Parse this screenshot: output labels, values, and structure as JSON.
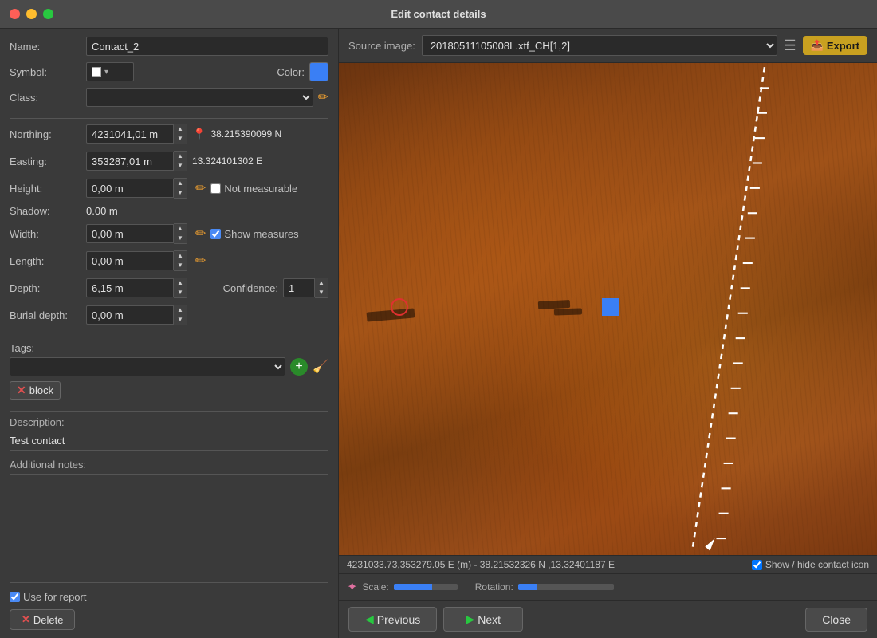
{
  "window": {
    "title": "Edit contact details"
  },
  "left_panel": {
    "name_label": "Name:",
    "name_value": "Contact_2",
    "symbol_label": "Symbol:",
    "color_label": "Color:",
    "class_label": "Class:",
    "northing_label": "Northing:",
    "northing_value": "4231041,01 m",
    "northing_coords": "38.215390099 N",
    "easting_label": "Easting:",
    "easting_value": "353287,01 m",
    "easting_coords": "13.324101302 E",
    "height_label": "Height:",
    "height_value": "0,00 m",
    "not_measurable_label": "Not measurable",
    "shadow_label": "Shadow:",
    "shadow_value": "0.00 m",
    "width_label": "Width:",
    "width_value": "0,00 m",
    "show_measures_label": "Show measures",
    "length_label": "Length:",
    "length_value": "0,00 m",
    "depth_label": "Depth:",
    "depth_value": "6,15 m",
    "confidence_label": "Confidence:",
    "confidence_value": "1",
    "burial_depth_label": "Burial depth:",
    "burial_depth_value": "0,00 m",
    "tags_label": "Tags:",
    "tag_block": "block",
    "description_label": "Description:",
    "description_value": "Test contact",
    "additional_notes_label": "Additional notes:",
    "use_for_report_label": "Use for report",
    "delete_label": "Delete"
  },
  "right_panel": {
    "source_label": "Source image:",
    "source_value": "20180511105008L.xtf_CH[1,2]",
    "export_label": "Export",
    "coords_value": "4231033.73,353279.05 E (m) - 38.21532326 N ,13.32401187 E",
    "show_hide_label": "Show / hide contact icon",
    "scale_label": "Scale:",
    "rotation_label": "Rotation:"
  },
  "nav": {
    "previous_label": "Previous",
    "next_label": "Next",
    "close_label": "Close"
  }
}
